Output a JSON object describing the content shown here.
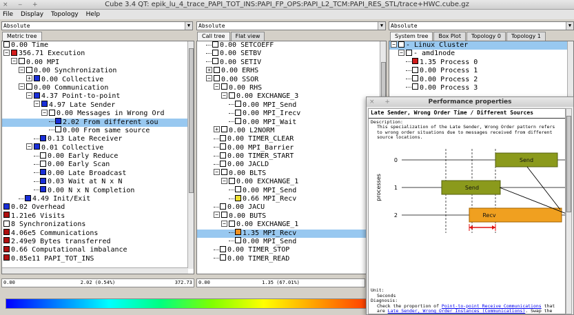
{
  "window": {
    "title": "Cube 3.4 QT: epik_lu_4_trace_PAPI_TOT_INS:PAPI_FP_OPS:PAPI_L2_TCM:PAPI_RES_STL/trace+HWC.cube.gz",
    "controls": "× ‒ +"
  },
  "menu": [
    "File",
    "Display",
    "Topology",
    "Help"
  ],
  "metric_pane": {
    "mode": "Absolute",
    "tabs": [
      "Metric tree"
    ],
    "rows": [
      {
        "indent": 0,
        "exp": "",
        "color": "#ffffff",
        "text": "0.00 Time"
      },
      {
        "indent": 0,
        "exp": "-",
        "color": "#d21c1c",
        "text": "356.71 Execution"
      },
      {
        "indent": 1,
        "exp": "-",
        "color": "#ffffff",
        "text": "0.00 MPI"
      },
      {
        "indent": 2,
        "exp": "-",
        "color": "#ffffff",
        "text": "0.00 Synchronization"
      },
      {
        "indent": 3,
        "exp": "+",
        "color": "#1a2fd8",
        "text": "0.00 Collective"
      },
      {
        "indent": 2,
        "exp": "-",
        "color": "#ffffff",
        "text": "0.00 Communication"
      },
      {
        "indent": 3,
        "exp": "-",
        "color": "#1a2fd8",
        "text": "4.37 Point-to-point"
      },
      {
        "indent": 4,
        "exp": "-",
        "color": "#1a2fd8",
        "text": "4.97 Late Sender"
      },
      {
        "indent": 5,
        "exp": "-",
        "color": "#ffffff",
        "text": "0.00 Messages in Wrong Ord"
      },
      {
        "indent": 6,
        "exp": "",
        "color": "#1a2fd8",
        "text": "2.02 From different sou",
        "selected": true
      },
      {
        "indent": 6,
        "exp": "",
        "color": "#ffffff",
        "text": "0.00 From same source"
      },
      {
        "indent": 4,
        "exp": "",
        "color": "#1a2fd8",
        "text": "0.13 Late Receiver"
      },
      {
        "indent": 3,
        "exp": "-",
        "color": "#1a2fd8",
        "text": "0.01 Collective"
      },
      {
        "indent": 4,
        "exp": "",
        "color": "#ffffff",
        "text": "0.00 Early Reduce"
      },
      {
        "indent": 4,
        "exp": "",
        "color": "#ffffff",
        "text": "0.00 Early Scan"
      },
      {
        "indent": 4,
        "exp": "",
        "color": "#1a2fd8",
        "text": "0.00 Late Broadcast"
      },
      {
        "indent": 4,
        "exp": "",
        "color": "#1a2fd8",
        "text": "0.03 Wait at N x N"
      },
      {
        "indent": 4,
        "exp": "",
        "color": "#1a2fd8",
        "text": "0.00 N x N Completion"
      },
      {
        "indent": 2,
        "exp": "",
        "color": "#1a2fd8",
        "text": "4.49 Init/Exit"
      },
      {
        "indent": 0,
        "exp": "",
        "color": "#1a2fd8",
        "text": "0.02 Overhead"
      },
      {
        "indent": 0,
        "exp": "",
        "color": "#b01010",
        "text": "1.21e6 Visits"
      },
      {
        "indent": 0,
        "exp": "",
        "color": "#ffffff",
        "text": "8 Synchronizations"
      },
      {
        "indent": 0,
        "exp": "",
        "color": "#b01010",
        "text": "4.06e5 Communications"
      },
      {
        "indent": 0,
        "exp": "",
        "color": "#b01010",
        "text": "2.49e9 Bytes transferred"
      },
      {
        "indent": 0,
        "exp": "",
        "color": "#b01010",
        "text": "0.66 Computational imbalance"
      },
      {
        "indent": 0,
        "exp": "",
        "color": "#b01010",
        "text": "0.85e11 PAPI_TOT_INS"
      }
    ],
    "status": {
      "left": "0.00",
      "mid": "2.02 (0.54%)",
      "right": "372.73"
    }
  },
  "call_pane": {
    "mode": "Absolute",
    "tabs": [
      "Call tree",
      "Flat view"
    ],
    "rows": [
      {
        "indent": 1,
        "exp": "",
        "color": "#ffffff",
        "text": "0.00 SETCOEFF"
      },
      {
        "indent": 1,
        "exp": "",
        "color": "#ffffff",
        "text": "0.00 SETBV"
      },
      {
        "indent": 1,
        "exp": "",
        "color": "#ffffff",
        "text": "0.00 SETIV"
      },
      {
        "indent": 1,
        "exp": "+",
        "color": "#ffffff",
        "text": "0.00 ERHS"
      },
      {
        "indent": 1,
        "exp": "-",
        "color": "#ffffff",
        "text": "0.00 SSOR"
      },
      {
        "indent": 2,
        "exp": "-",
        "color": "#ffffff",
        "text": "0.00 RHS"
      },
      {
        "indent": 3,
        "exp": "-",
        "color": "#ffffff",
        "text": "0.00 EXCHANGE_3"
      },
      {
        "indent": 4,
        "exp": "",
        "color": "#ffffff",
        "text": "0.00 MPI_Send"
      },
      {
        "indent": 4,
        "exp": "",
        "color": "#ffffff",
        "text": "0.00 MPI_Irecv"
      },
      {
        "indent": 4,
        "exp": "",
        "color": "#ffffff",
        "text": "0.00 MPI_Wait"
      },
      {
        "indent": 2,
        "exp": "+",
        "color": "#ffffff",
        "text": "0.00 L2NORM"
      },
      {
        "indent": 2,
        "exp": "",
        "color": "#ffffff",
        "text": "0.00 TIMER_CLEAR"
      },
      {
        "indent": 2,
        "exp": "",
        "color": "#ffffff",
        "text": "0.00 MPI_Barrier"
      },
      {
        "indent": 2,
        "exp": "",
        "color": "#ffffff",
        "text": "0.00 TIMER_START"
      },
      {
        "indent": 2,
        "exp": "",
        "color": "#ffffff",
        "text": "0.00 JACLD"
      },
      {
        "indent": 2,
        "exp": "-",
        "color": "#ffffff",
        "text": "0.00 BLTS"
      },
      {
        "indent": 3,
        "exp": "-",
        "color": "#ffffff",
        "text": "0.00 EXCHANGE_1"
      },
      {
        "indent": 4,
        "exp": "",
        "color": "#ffffff",
        "text": "0.00 MPI_Send"
      },
      {
        "indent": 4,
        "exp": "",
        "color": "#f0e030",
        "text": "0.66 MPI_Recv"
      },
      {
        "indent": 2,
        "exp": "",
        "color": "#ffffff",
        "text": "0.00 JACU"
      },
      {
        "indent": 2,
        "exp": "-",
        "color": "#ffffff",
        "text": "0.00 BUTS"
      },
      {
        "indent": 3,
        "exp": "-",
        "color": "#ffffff",
        "text": "0.00 EXCHANGE_1"
      },
      {
        "indent": 4,
        "exp": "",
        "color": "#f09020",
        "text": "1.35 MPI_Recv",
        "selected": true
      },
      {
        "indent": 4,
        "exp": "",
        "color": "#ffffff",
        "text": "0.00 MPI_Send"
      },
      {
        "indent": 2,
        "exp": "",
        "color": "#ffffff",
        "text": "0.00 TIMER_STOP"
      },
      {
        "indent": 2,
        "exp": "",
        "color": "#ffffff",
        "text": "0.00 TIMER_READ"
      }
    ],
    "status": {
      "left": "0.00",
      "mid": "1.35 (67.01%)",
      "right": ""
    }
  },
  "system_pane": {
    "mode": "Absolute",
    "tabs": [
      "System tree",
      "Box Plot",
      "Topology 0",
      "Topology 1"
    ],
    "rows": [
      {
        "indent": 0,
        "exp": "-",
        "color": "#ffffff",
        "text": "- Linux Cluster",
        "selected": true
      },
      {
        "indent": 1,
        "exp": "-",
        "color": "#ffffff",
        "text": "- amd1node"
      },
      {
        "indent": 2,
        "exp": "",
        "color": "#d21c1c",
        "text": "1.35 Process 0"
      },
      {
        "indent": 2,
        "exp": "",
        "color": "#ffffff",
        "text": "0.00 Process 1"
      },
      {
        "indent": 2,
        "exp": "",
        "color": "#ffffff",
        "text": "0.00 Process 2"
      },
      {
        "indent": 2,
        "exp": "",
        "color": "#ffffff",
        "text": "0.00 Process 3"
      }
    ]
  },
  "dialog": {
    "window_controls": "× +",
    "title": "Performance properties",
    "heading": "Late Sender, Wrong Order Time / Different Sources",
    "desc_label": "Description:",
    "desc_text": "This specialization of the Late Sender, Wrong Order pattern refers to wrong order situations due to messages received from different source locations.",
    "diagram": {
      "ylabel": "processes",
      "ticks": [
        "0",
        "1",
        "2"
      ],
      "send0": "Send",
      "send1": "Send",
      "recv2": "Recv"
    },
    "unit_label": "Unit:",
    "unit_value": "Seconds",
    "diag_label": "Diagnosis:",
    "diag_pre": "Check the proportion of ",
    "diag_link1": "Point-to-point Receive Communications",
    "diag_mid": " that are ",
    "diag_link2": "Late Sender, Wrong Order Instances (Communications)",
    "diag_post": ". Swap the order of receiving from different sources to match the most common ordering. Consider using the wildcard MPI_ANY_SOURCE to receive (and process) messages as they arrive from any source rank."
  }
}
